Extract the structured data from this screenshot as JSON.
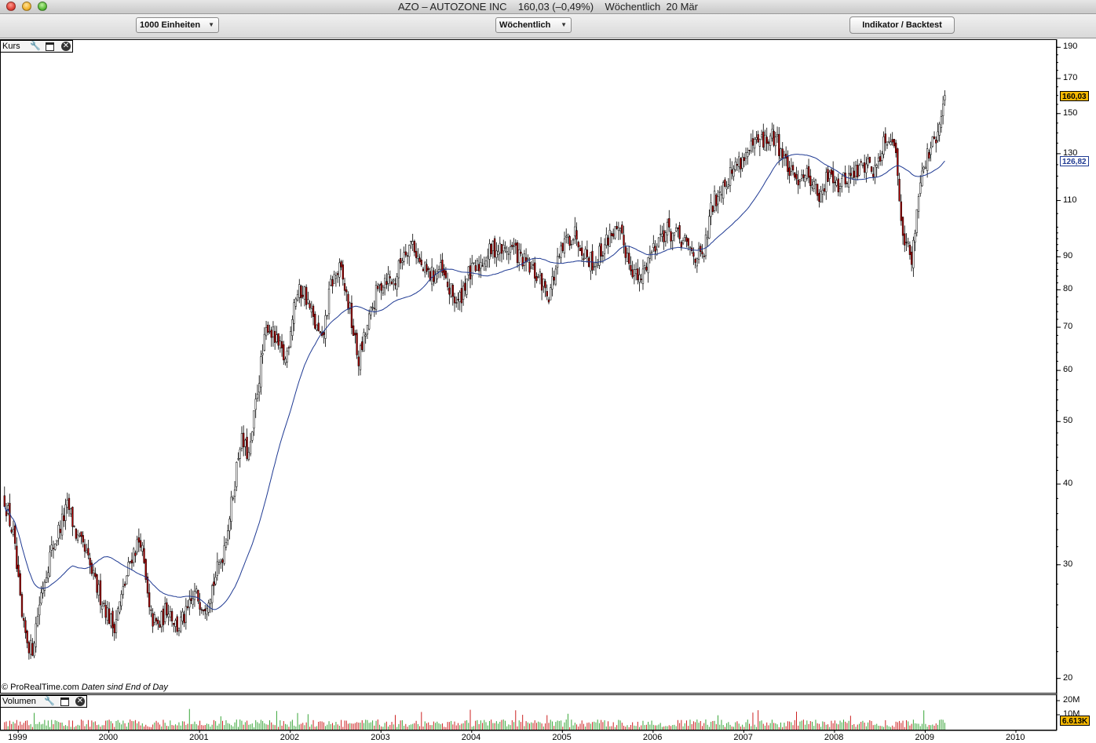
{
  "window": {
    "title": "AZO – AUTOZONE INC    160,03 (–0,49%)    Wöchentlich  20 Mär"
  },
  "toolbar": {
    "units_select": "1000 Einheiten",
    "period_select": "Wöchentlich",
    "indicator_button": "Indikator / Backtest"
  },
  "price_panel": {
    "label": "Kurs",
    "y_ticks": [
      "190",
      "170",
      "150",
      "130",
      "110",
      "90",
      "80",
      "70",
      "60",
      "50",
      "40",
      "30",
      "20"
    ],
    "last_price_badge": "160,03",
    "ma_badge": "126,82",
    "footnote_source": "© ProRealTime.com",
    "footnote_note": "Daten sind End of Day"
  },
  "volume_panel": {
    "label": "Volumen",
    "y_ticks": [
      "20M",
      "10M"
    ],
    "last_volume_badge": "6.613K"
  },
  "x_ticks": [
    "1999",
    "2000",
    "2001",
    "2002",
    "2003",
    "2004",
    "2005",
    "2006",
    "2007",
    "2008",
    "2009",
    "2010"
  ],
  "colors": {
    "up_candle": "#ffffff",
    "down_candle": "#b00000",
    "moving_average": "#1f3a93",
    "price_badge": "#f5b800",
    "ma_badge_border": "#1f3a93",
    "volume_up": "#3aa63a",
    "volume_down": "#cc2222"
  },
  "chart_data": {
    "type": "candlestick",
    "title": "AZO – AUTOZONE INC",
    "interval": "weekly",
    "y_scale": "log",
    "ylim": [
      19,
      195
    ],
    "x_range": [
      "1998-10",
      "2010-06"
    ],
    "series": [
      {
        "name": "Kurs",
        "approx_weekly_close": [
          [
            1998.85,
            38
          ],
          [
            1998.95,
            33
          ],
          [
            1999.05,
            24
          ],
          [
            1999.15,
            22
          ],
          [
            1999.25,
            27
          ],
          [
            1999.35,
            31
          ],
          [
            1999.45,
            34
          ],
          [
            1999.55,
            37
          ],
          [
            1999.65,
            33
          ],
          [
            1999.75,
            31
          ],
          [
            1999.85,
            28
          ],
          [
            1999.95,
            26
          ],
          [
            2000.05,
            24
          ],
          [
            2000.15,
            27
          ],
          [
            2000.25,
            31
          ],
          [
            2000.35,
            33
          ],
          [
            2000.45,
            25
          ],
          [
            2000.55,
            24
          ],
          [
            2000.65,
            26
          ],
          [
            2000.75,
            24
          ],
          [
            2000.85,
            25
          ],
          [
            2000.95,
            27
          ],
          [
            2001.05,
            26
          ],
          [
            2001.15,
            28
          ],
          [
            2001.25,
            31
          ],
          [
            2001.35,
            37
          ],
          [
            2001.45,
            47
          ],
          [
            2001.55,
            44
          ],
          [
            2001.65,
            58
          ],
          [
            2001.75,
            71
          ],
          [
            2001.85,
            66
          ],
          [
            2001.95,
            62
          ],
          [
            2002.05,
            78
          ],
          [
            2002.15,
            80
          ],
          [
            2002.25,
            72
          ],
          [
            2002.35,
            66
          ],
          [
            2002.45,
            82
          ],
          [
            2002.55,
            86
          ],
          [
            2002.65,
            75
          ],
          [
            2002.75,
            62
          ],
          [
            2002.85,
            70
          ],
          [
            2002.95,
            79
          ],
          [
            2003.05,
            84
          ],
          [
            2003.15,
            82
          ],
          [
            2003.25,
            92
          ],
          [
            2003.35,
            95
          ],
          [
            2003.45,
            86
          ],
          [
            2003.55,
            84
          ],
          [
            2003.65,
            86
          ],
          [
            2003.75,
            80
          ],
          [
            2003.85,
            76
          ],
          [
            2003.95,
            84
          ],
          [
            2004.05,
            86
          ],
          [
            2004.15,
            90
          ],
          [
            2004.25,
            93
          ],
          [
            2004.35,
            92
          ],
          [
            2004.45,
            93
          ],
          [
            2004.55,
            89
          ],
          [
            2004.65,
            86
          ],
          [
            2004.75,
            83
          ],
          [
            2004.85,
            79
          ],
          [
            2004.95,
            88
          ],
          [
            2005.05,
            96
          ],
          [
            2005.15,
            98
          ],
          [
            2005.25,
            91
          ],
          [
            2005.35,
            88
          ],
          [
            2005.45,
            93
          ],
          [
            2005.55,
            99
          ],
          [
            2005.65,
            96
          ],
          [
            2005.75,
            88
          ],
          [
            2005.85,
            82
          ],
          [
            2005.95,
            90
          ],
          [
            2006.05,
            96
          ],
          [
            2006.15,
            99
          ],
          [
            2006.25,
            97
          ],
          [
            2006.35,
            94
          ],
          [
            2006.45,
            91
          ],
          [
            2006.55,
            89
          ],
          [
            2006.65,
            108
          ],
          [
            2006.75,
            116
          ],
          [
            2006.85,
            121
          ],
          [
            2006.95,
            127
          ],
          [
            2007.05,
            130
          ],
          [
            2007.15,
            135
          ],
          [
            2007.25,
            136
          ],
          [
            2007.35,
            138
          ],
          [
            2007.45,
            127
          ],
          [
            2007.55,
            118
          ],
          [
            2007.65,
            122
          ],
          [
            2007.75,
            119
          ],
          [
            2007.85,
            110
          ],
          [
            2007.95,
            124
          ],
          [
            2008.05,
            116
          ],
          [
            2008.15,
            120
          ],
          [
            2008.25,
            122
          ],
          [
            2008.35,
            126
          ],
          [
            2008.45,
            122
          ],
          [
            2008.55,
            138
          ],
          [
            2008.65,
            139
          ],
          [
            2008.75,
            100
          ],
          [
            2008.85,
            88
          ],
          [
            2008.95,
            122
          ],
          [
            2009.05,
            131
          ],
          [
            2009.15,
            140
          ],
          [
            2009.22,
            160.03
          ]
        ]
      },
      {
        "name": "Moving Average",
        "last_value": 126.82
      }
    ]
  }
}
